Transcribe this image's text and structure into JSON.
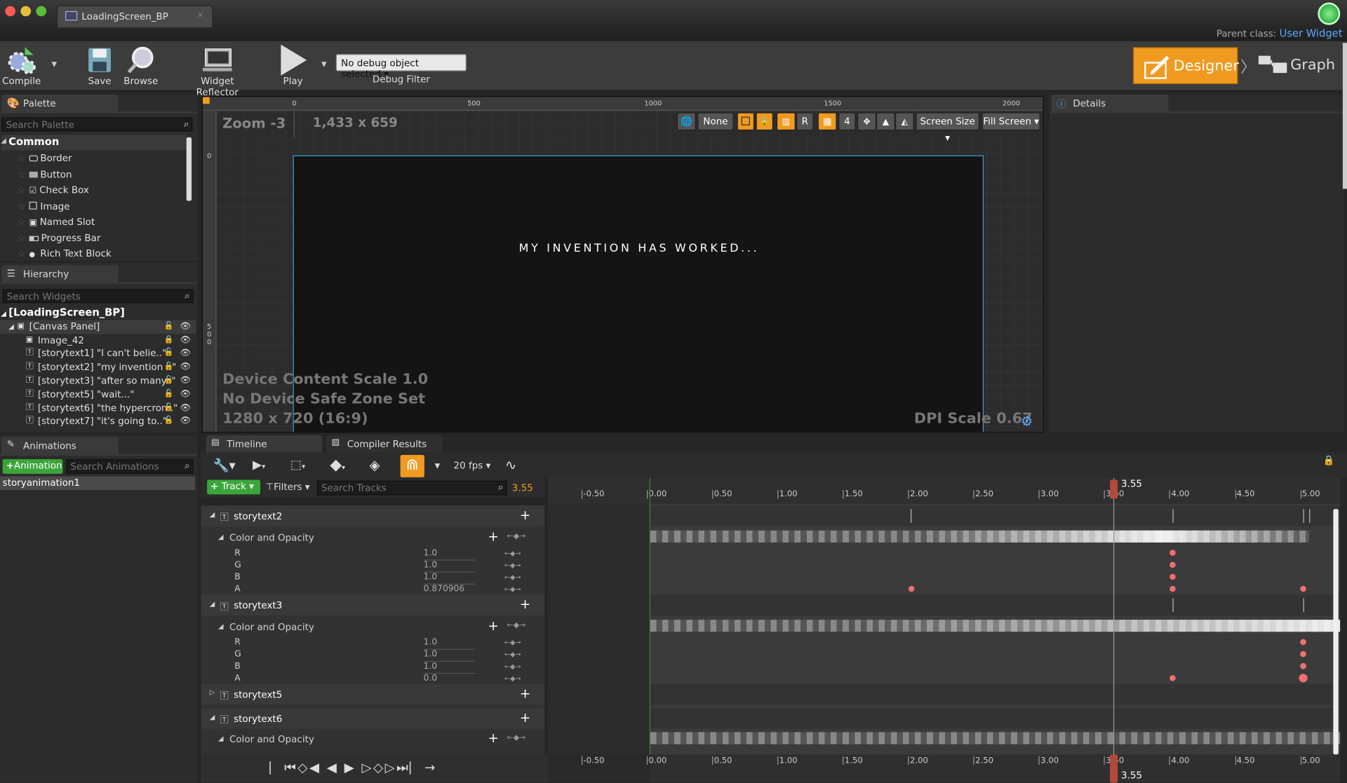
{
  "app": {
    "tab_title": "LoadingScreen_BP",
    "parent_class_label": "Parent class:",
    "parent_class": "User Widget"
  },
  "toolbar": {
    "compile": "Compile",
    "save": "Save",
    "browse": "Browse",
    "widget_reflector": "Widget Reflector",
    "play": "Play",
    "debug_object": "No debug object selected",
    "debug_filter": "Debug Filter",
    "designer": "Designer",
    "graph": "Graph"
  },
  "palette": {
    "title": "Palette",
    "search_placeholder": "Search Palette",
    "category": "Common",
    "items": [
      "Border",
      "Button",
      "Check Box",
      "Image",
      "Named Slot",
      "Progress Bar",
      "Rich Text Block"
    ]
  },
  "hierarchy": {
    "title": "Hierarchy",
    "search_placeholder": "Search Widgets",
    "root": "[LoadingScreen_BP]",
    "items": [
      "[Canvas Panel]",
      "Image_42",
      "[storytext1] \"I can't belie..\"",
      "[storytext2] \"my invention ..\"",
      "[storytext3] \"after so many..\"",
      "[storytext5] \"wait...\"",
      "[storytext6] \"the hypercron..\"",
      "[storytext7] \"it's going to..\""
    ]
  },
  "viewport": {
    "zoom": "Zoom -3",
    "resolution": "1,433 x 659",
    "ruler_x": [
      "0",
      "500",
      "1000",
      "1500",
      "2000"
    ],
    "ruler_y": [
      "0",
      "5",
      "0",
      "0"
    ],
    "none_label": "None",
    "r_label": "R",
    "grid_value": "4",
    "screen_size": "Screen Size",
    "fill_screen": "Fill Screen",
    "canvas_text": "MY INVENTION HAS WORKED...",
    "device_scale": "Device Content Scale 1.0",
    "safe_zone": "No Device Safe Zone Set",
    "aspect": "1280 x 720 (16:9)",
    "dpi": "DPI Scale 0.67"
  },
  "details": {
    "title": "Details"
  },
  "animations": {
    "title": "Animations",
    "add_label": "Animation",
    "search_placeholder": "Search Animations",
    "items": [
      "storyanimation1"
    ]
  },
  "timeline": {
    "tab_timeline": "Timeline",
    "tab_compiler": "Compiler Results",
    "fps": "20 fps",
    "track_label": "Track",
    "filters_label": "Filters",
    "search_placeholder": "Search Tracks",
    "current_time": "3.55",
    "ticks": [
      "-0.50",
      "0.00",
      "0.50",
      "1.00",
      "1.50",
      "2.00",
      "2.50",
      "3.00",
      "3.50",
      "4.00",
      "4.50",
      "5.00"
    ],
    "tracks": [
      {
        "name": "storytext2",
        "property": "Color and Opacity",
        "channels": [
          {
            "n": "R",
            "v": "1.0"
          },
          {
            "n": "G",
            "v": "1.0"
          },
          {
            "n": "B",
            "v": "1.0"
          },
          {
            "n": "A",
            "v": "0.870906"
          }
        ]
      },
      {
        "name": "storytext3",
        "property": "Color and Opacity",
        "channels": [
          {
            "n": "R",
            "v": "1.0"
          },
          {
            "n": "G",
            "v": "1.0"
          },
          {
            "n": "B",
            "v": "1.0"
          },
          {
            "n": "A",
            "v": "0.0"
          }
        ]
      },
      {
        "name": "storytext5"
      },
      {
        "name": "storytext6",
        "property": "Color and Opacity"
      }
    ]
  },
  "colors": {
    "accent": "#f09a20",
    "add_green": "#3aa63a",
    "key": "#f07070",
    "playhead": "#c05040"
  }
}
